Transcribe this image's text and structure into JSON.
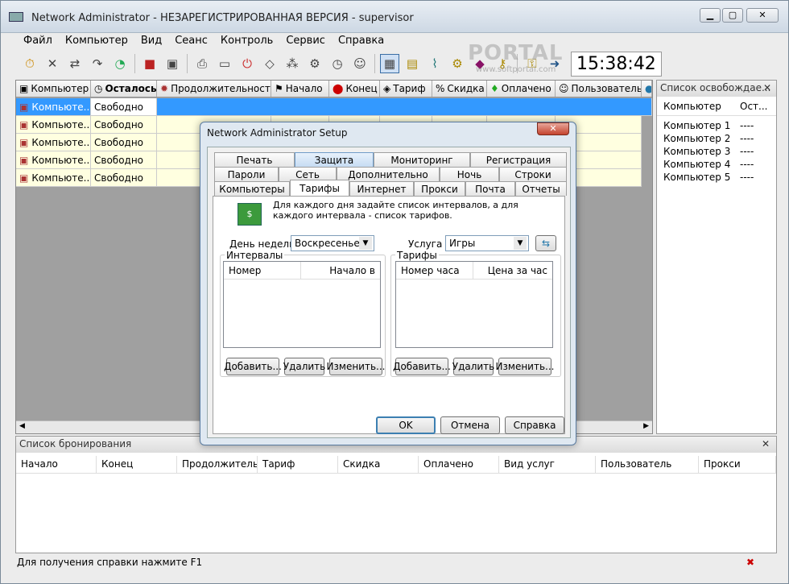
{
  "window": {
    "title": "Network Administrator - НЕЗАРЕГИСТРИРОВАННАЯ ВЕРСИЯ - supervisor"
  },
  "menu": [
    "Файл",
    "Компьютер",
    "Вид",
    "Сеанс",
    "Контроль",
    "Сервис",
    "Справка"
  ],
  "clock": "15:38:42",
  "grid": {
    "columns": [
      "Компьютер",
      "Осталось",
      "Продолжительность",
      "Начало",
      "Конец",
      "Тариф",
      "Скидка",
      "Оплачено",
      "Пользователь"
    ],
    "rows": [
      {
        "computer": "Компьюте...",
        "status": "Свободно"
      },
      {
        "computer": "Компьюте...",
        "status": "Свободно"
      },
      {
        "computer": "Компьюте...",
        "status": "Свободно"
      },
      {
        "computer": "Компьюте...",
        "status": "Свободно"
      },
      {
        "computer": "Компьюте...",
        "status": "Свободно"
      }
    ]
  },
  "free_panel": {
    "title": "Список освобождае...",
    "col1": "Компьютер",
    "col2": "Ост...",
    "items": [
      {
        "name": "Компьютер 1",
        "value": "----"
      },
      {
        "name": "Компьютер 2",
        "value": "----"
      },
      {
        "name": "Компьютер 3",
        "value": "----"
      },
      {
        "name": "Компьютер 4",
        "value": "----"
      },
      {
        "name": "Компьютер 5",
        "value": "----"
      }
    ]
  },
  "booking": {
    "title": "Список бронирования",
    "columns": [
      "Начало",
      "Конец",
      "Продолжитель...",
      "Тариф",
      "Скидка",
      "Оплачено",
      "Вид услуг",
      "Пользователь",
      "Прокси"
    ]
  },
  "status": "Для получения справки нажмите F1",
  "dialog": {
    "title": "Network Administrator Setup",
    "tabs_row1": [
      "Печать",
      "Защита",
      "Мониторинг",
      "Регистрация"
    ],
    "tabs_row2": [
      "Пароли",
      "Сеть",
      "Дополнительно",
      "Ночь",
      "Строки"
    ],
    "tabs_row3": [
      "Компьютеры",
      "Тарифы",
      "Интернет",
      "Прокси",
      "Почта",
      "Отчеты"
    ],
    "description": "Для каждого дня задайте список интервалов, а для каждого интервала - список тарифов.",
    "day_label": "День недели",
    "day_value": "Воскресенье",
    "service_label": "Услуга",
    "service_value": "Игры",
    "intervals": {
      "title": "Интервалы",
      "col1": "Номер",
      "col2": "Начало в"
    },
    "tariffs": {
      "title": "Тарифы",
      "col1": "Номер часа",
      "col2": "Цена за час"
    },
    "add": "Добавить...",
    "delete": "Удалить",
    "edit": "Изменить...",
    "ok": "OK",
    "cancel": "Отмена",
    "help": "Справка"
  },
  "watermark": "PORTAL",
  "watermark_url": "www.softportal.com"
}
